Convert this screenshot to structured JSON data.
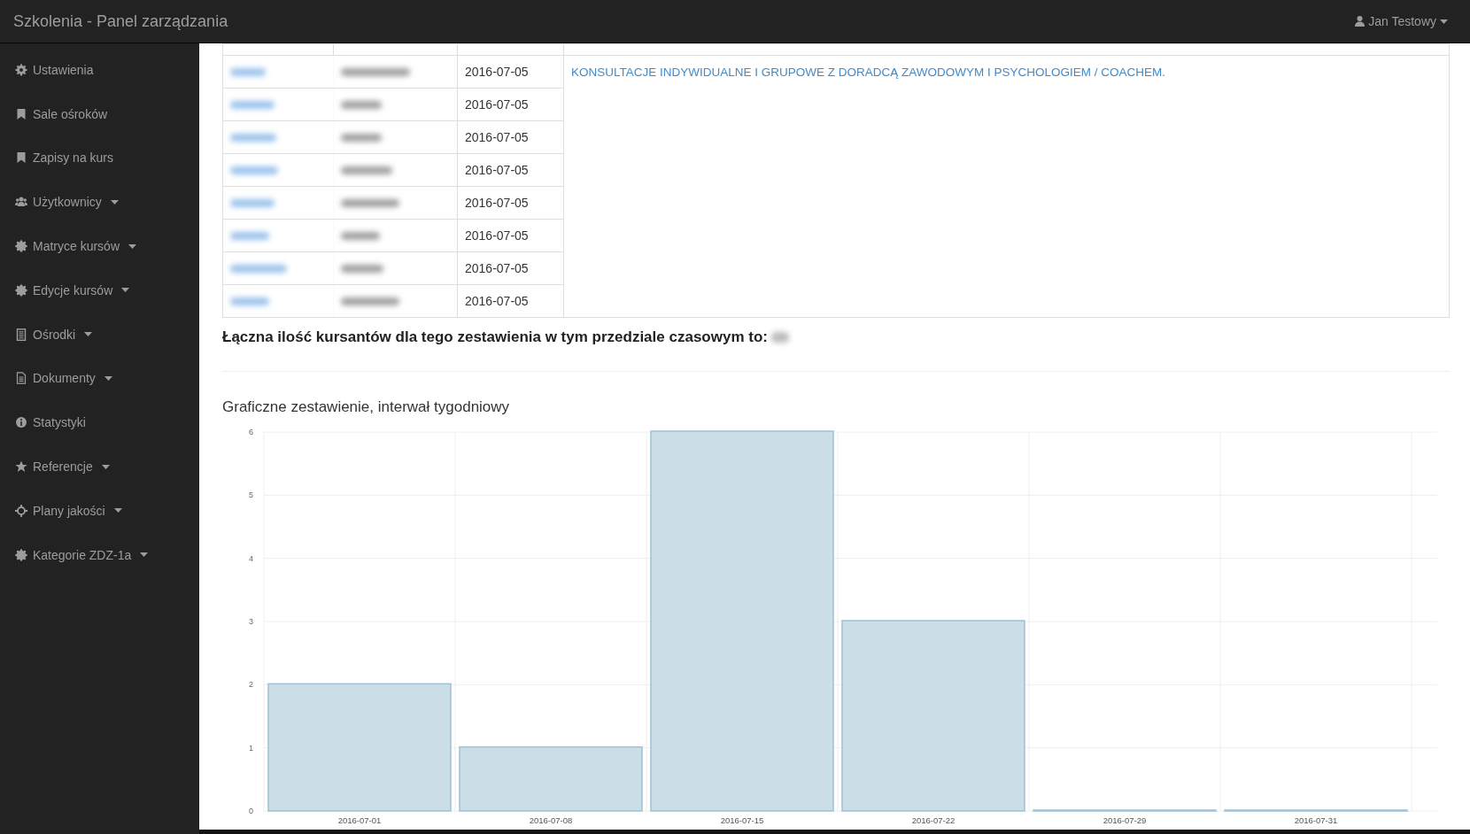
{
  "navbar": {
    "brand": "Szkolenia - Panel zarządzania",
    "user": "Jan Testowy"
  },
  "sidebar": {
    "items": [
      {
        "label": "Ustawienia",
        "has_menu": false
      },
      {
        "label": "Sale ośroków",
        "has_menu": false
      },
      {
        "label": "Zapisy na kurs",
        "has_menu": false
      },
      {
        "label": "Użytkownicy",
        "has_menu": true
      },
      {
        "label": "Matryce kursów",
        "has_menu": true
      },
      {
        "label": "Edycje kursów",
        "has_menu": true
      },
      {
        "label": "Ośrodki",
        "has_menu": true
      },
      {
        "label": "Dokumenty",
        "has_menu": true
      },
      {
        "label": "Statystyki",
        "has_menu": false
      },
      {
        "label": "Referencje",
        "has_menu": true
      },
      {
        "label": "Plany jakości",
        "has_menu": true
      },
      {
        "label": "Kategorie ZDZ-1a",
        "has_menu": true
      }
    ]
  },
  "table": {
    "course": "KONSULTACJE INDYWIDUALNE I GRUPOWE Z DORADCĄ ZAWODOWYM I PSYCHOLOGIEM / COACHEM.",
    "rows": [
      {
        "date": "2016-07-05"
      },
      {
        "date": "2016-07-05"
      },
      {
        "date": "2016-07-05"
      },
      {
        "date": "2016-07-05"
      },
      {
        "date": "2016-07-05"
      },
      {
        "date": "2016-07-05"
      },
      {
        "date": "2016-07-05"
      },
      {
        "date": "2016-07-05"
      }
    ]
  },
  "summary": "Łączna ilość kursantów dla tego zestawienia w tym przedziale czasowym to:",
  "chart_title": "Graficzne zestawienie, interwał tygodniowy",
  "chart_data": {
    "type": "bar",
    "categories": [
      "2016-07-01",
      "2016-07-08",
      "2016-07-15",
      "2016-07-22",
      "2016-07-29",
      "2016-07-31"
    ],
    "series": [
      {
        "color": "#cbdde6",
        "values": [
          2,
          1,
          6,
          3,
          0,
          0
        ]
      }
    ],
    "grid": true,
    "ylim": [
      0,
      6
    ],
    "yticks": [
      0,
      1,
      2,
      3,
      4,
      5,
      6
    ]
  }
}
